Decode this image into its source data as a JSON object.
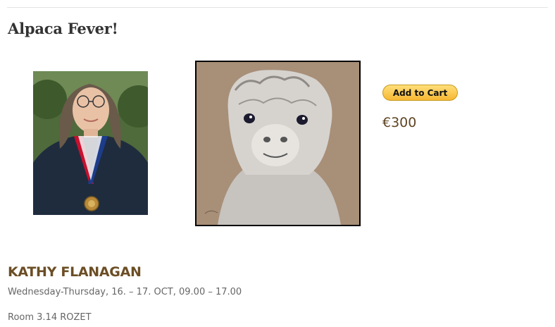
{
  "product": {
    "title": "Alpaca Fever!",
    "add_to_cart_label": "Add to Cart",
    "price": "€300"
  },
  "artist": {
    "name": "KATHY FLANAGAN",
    "schedule": "Wednesday-Thursday, 16. – 17. OCT, 09.00 – 17.00",
    "room": "Room 3.14 ROZET"
  },
  "colors": {
    "button_gradient_top": "#ffdf7a",
    "button_gradient_bottom": "#f7b733",
    "price_text": "#5f4524",
    "artist_name_text": "#6b4e25"
  }
}
